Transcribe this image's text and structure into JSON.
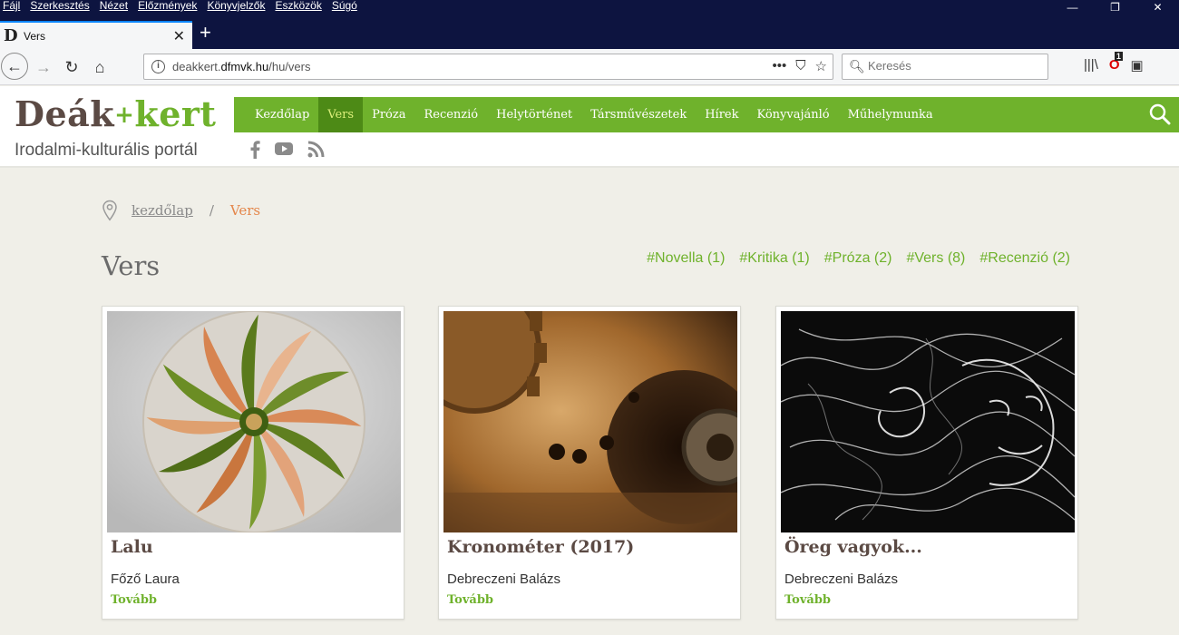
{
  "browser": {
    "menu": [
      "Fájl",
      "Szerkesztés",
      "Nézet",
      "Előzmények",
      "Könyvjelzők",
      "Eszközök",
      "Súgó"
    ],
    "tab_title": "Vers",
    "url_prefix": "deakkert.",
    "url_domain": "dfmvk.hu",
    "url_path": "/hu/vers",
    "search_placeholder": "Keresés",
    "notification_count": "1"
  },
  "site": {
    "logo_deak": "Deák",
    "logo_plus": "+",
    "logo_kert": "kert",
    "tagline": "Irodalmi-kulturális portál",
    "nav": [
      "Kezdőlap",
      "Vers",
      "Próza",
      "Recenzió",
      "Helytörténet",
      "Társművészetek",
      "Hírek",
      "Könyvajánló",
      "Műhelymunka"
    ],
    "active_nav": "Vers"
  },
  "breadcrumb": {
    "home": "kezdőlap",
    "separator": "/",
    "current": "Vers"
  },
  "page": {
    "title": "Vers",
    "tags": [
      "#Novella (1)",
      "#Kritika (1)",
      "#Próza (2)",
      "#Vers (8)",
      "#Recenzió (2)"
    ]
  },
  "cards": [
    {
      "title": "Lalu",
      "author": "Főző Laura",
      "more": "Tovább",
      "image": "mandala-art"
    },
    {
      "title": "Kronométer (2017)",
      "author": "Debreczeni Balázs",
      "more": "Tovább",
      "image": "clockwork-gears"
    },
    {
      "title": "Öreg vagyok...",
      "author": "Debreczeni Balázs",
      "more": "Tovább",
      "image": "smoke-face"
    }
  ],
  "colors": {
    "brand_green": "#6fb22c",
    "brand_brown": "#5b4a44",
    "accent_orange": "#e4864a",
    "page_bg": "#f0efe8"
  }
}
